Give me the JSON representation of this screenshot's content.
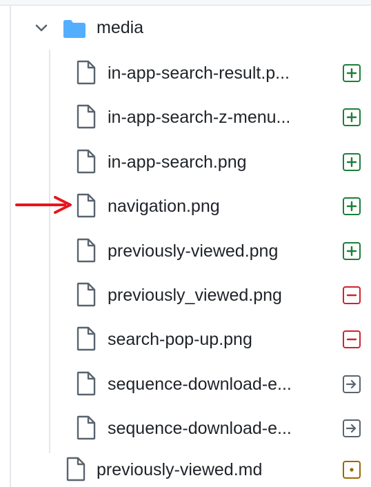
{
  "tree": {
    "folder": {
      "name": "media",
      "icon": "folder-icon",
      "expanded": true
    },
    "files": [
      {
        "name": "in-app-search-result.png",
        "display": "in-app-search-result.p...",
        "status": "added",
        "icon": "file-icon"
      },
      {
        "name": "in-app-search-z-menu.png",
        "display": "in-app-search-z-menu...",
        "status": "added",
        "icon": "file-icon"
      },
      {
        "name": "in-app-search.png",
        "display": "in-app-search.png",
        "status": "added",
        "icon": "file-icon"
      },
      {
        "name": "navigation.png",
        "display": "navigation.png",
        "status": "added",
        "icon": "file-icon"
      },
      {
        "name": "previously-viewed.png",
        "display": "previously-viewed.png",
        "status": "added",
        "icon": "file-icon"
      },
      {
        "name": "previously_viewed.png",
        "display": "previously_viewed.png",
        "status": "removed",
        "icon": "file-icon"
      },
      {
        "name": "search-pop-up.png",
        "display": "search-pop-up.png",
        "status": "removed",
        "icon": "file-icon"
      },
      {
        "name": "sequence-download-e...",
        "display": "sequence-download-e...",
        "status": "renamed",
        "icon": "file-icon"
      },
      {
        "name": "sequence-download-e...",
        "display": "sequence-download-e...",
        "status": "renamed",
        "icon": "file-icon"
      }
    ],
    "root_file": {
      "name": "previously-viewed.md",
      "display": "previously-viewed.md",
      "status": "modified",
      "icon": "file-icon"
    }
  },
  "annotation": {
    "icon": "red-arrow-icon",
    "color": "#e8151b",
    "points_to": "navigation.png"
  },
  "colors": {
    "added": "#1a7f37",
    "removed": "#cf222e",
    "renamed": "#59636e",
    "modified": "#9a6700",
    "folder": "#54aeff"
  }
}
